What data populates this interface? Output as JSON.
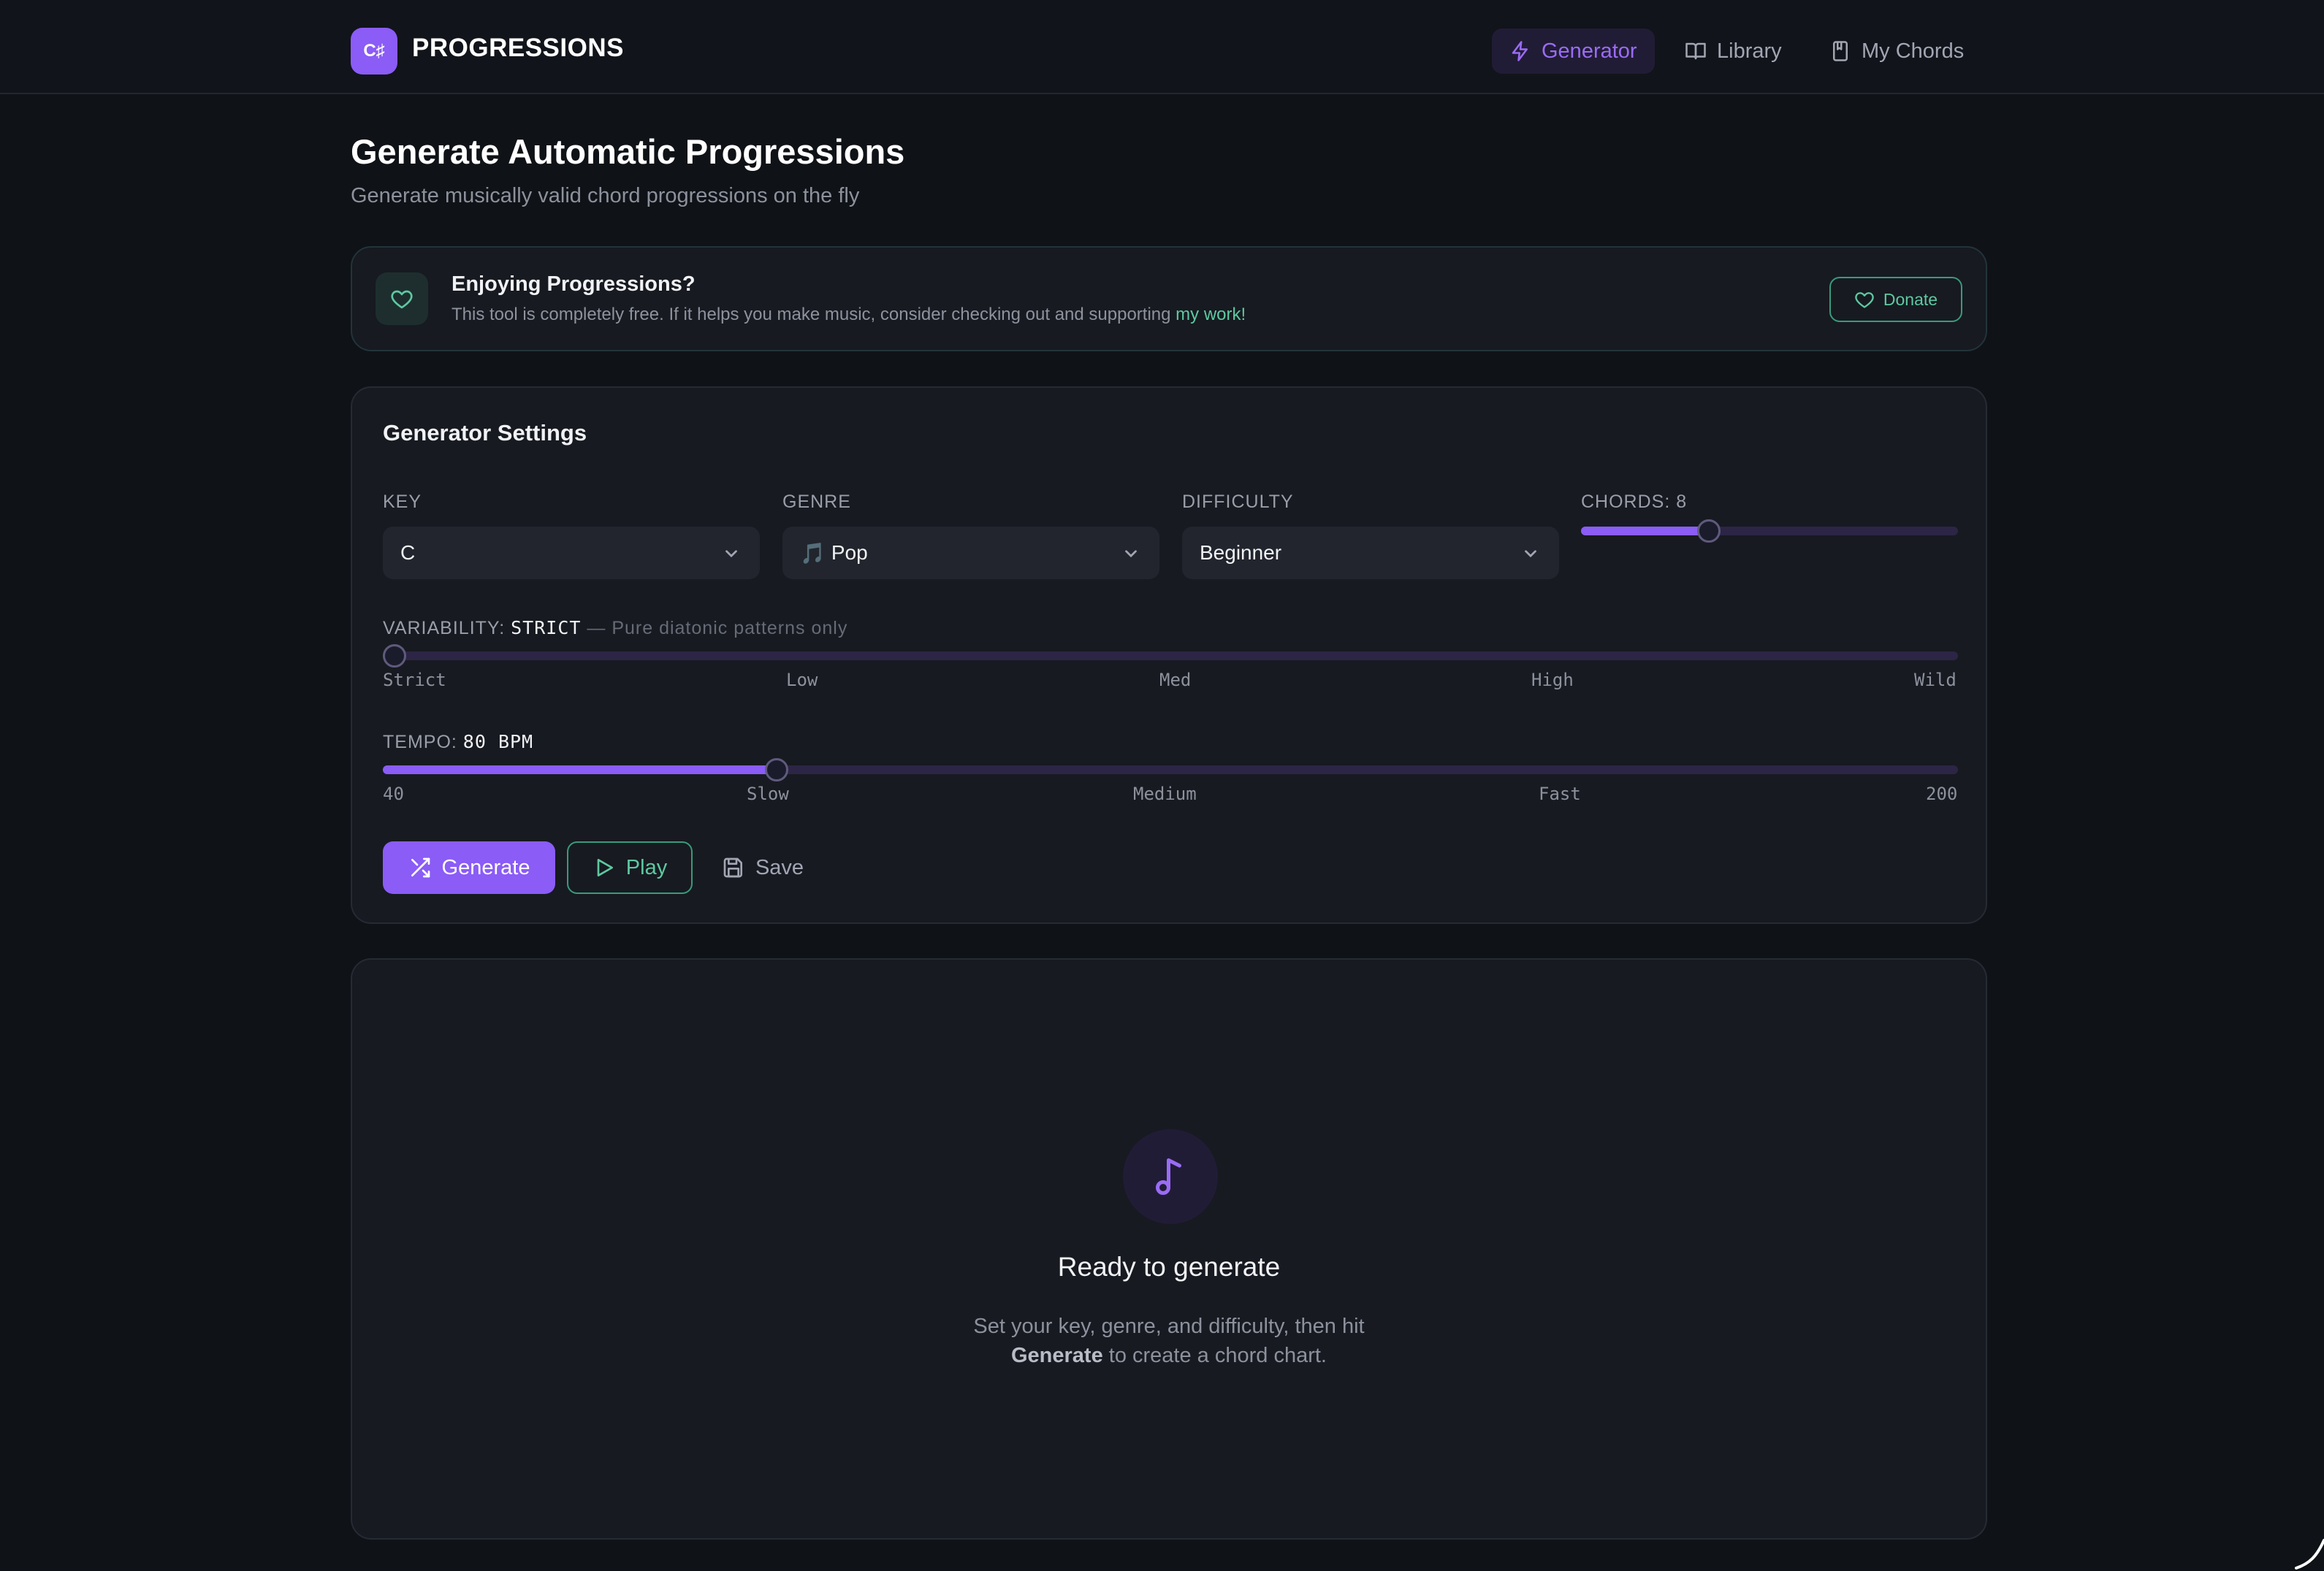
{
  "header": {
    "logo_text": "C♯",
    "brand": "PROGRESSIONS",
    "nav": [
      {
        "label": "Generator",
        "icon": "lightning-icon",
        "active": true
      },
      {
        "label": "Library",
        "icon": "book-open-icon",
        "active": false
      },
      {
        "label": "My Chords",
        "icon": "bookmark-book-icon",
        "active": false
      }
    ]
  },
  "page": {
    "title": "Generate Automatic Progressions",
    "subtitle": "Generate musically valid chord progressions on the fly"
  },
  "donate": {
    "title": "Enjoying Progressions?",
    "text_before": "This tool is completely free. If it helps you make music, consider checking out and supporting ",
    "link": "my work",
    "text_after": "!",
    "button": "Donate"
  },
  "settings": {
    "title": "Generator Settings",
    "key": {
      "label": "KEY",
      "value": "C"
    },
    "genre": {
      "label": "GENRE",
      "icon": "🎵",
      "value": "Pop"
    },
    "difficulty": {
      "label": "DIFFICULTY",
      "value": "Beginner"
    },
    "chords": {
      "label": "CHORDS:",
      "value": "8",
      "fill_fraction": 0.34
    },
    "variability": {
      "label": "VARIABILITY:",
      "value": "STRICT",
      "hint": "— Pure diatonic patterns only",
      "fill_fraction": 0.0,
      "ticks": [
        "Strict",
        "Low",
        "Med",
        "High",
        "Wild"
      ]
    },
    "tempo": {
      "label": "TEMPO:",
      "value": "80 BPM",
      "fill_fraction": 0.25,
      "ticks": [
        "40",
        "Slow",
        "Medium",
        "Fast",
        "200"
      ]
    },
    "buttons": {
      "generate": "Generate",
      "play": "Play",
      "save": "Save"
    }
  },
  "empty_state": {
    "title": "Ready to generate",
    "line1": "Set your key, genre, and difficulty, then hit",
    "line2_bold": "Generate",
    "line2_rest": " to create a chord chart."
  },
  "colors": {
    "accent": "#8b5cf6",
    "teal": "#5ec9a0",
    "background": "#0f1217",
    "card": "#171a21"
  }
}
